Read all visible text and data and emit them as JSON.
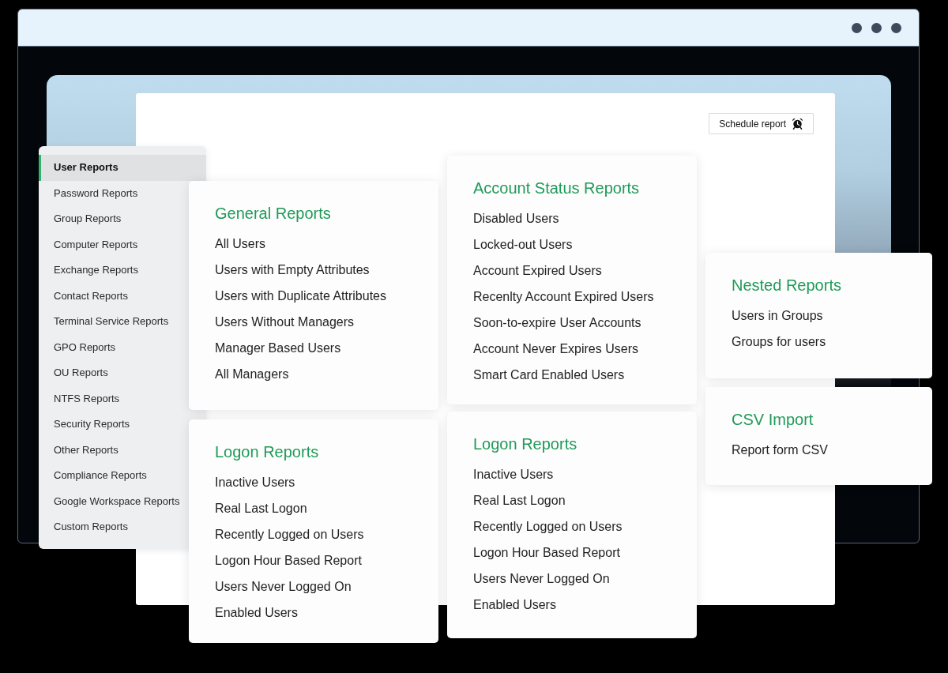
{
  "schedule_button": {
    "label": "Schedule report"
  },
  "sidebar": {
    "items": [
      {
        "label": "User Reports",
        "selected": true
      },
      {
        "label": "Password Reports",
        "selected": false
      },
      {
        "label": "Group Reports",
        "selected": false
      },
      {
        "label": "Computer Reports",
        "selected": false
      },
      {
        "label": "Exchange Reports",
        "selected": false
      },
      {
        "label": "Contact Reports",
        "selected": false
      },
      {
        "label": "Terminal Service Reports",
        "selected": false
      },
      {
        "label": "GPO Reports",
        "selected": false
      },
      {
        "label": "OU Reports",
        "selected": false
      },
      {
        "label": "NTFS Reports",
        "selected": false
      },
      {
        "label": "Security Reports",
        "selected": false
      },
      {
        "label": "Other Reports",
        "selected": false
      },
      {
        "label": "Compliance Reports",
        "selected": false
      },
      {
        "label": "Google Workspace Reports",
        "selected": false
      },
      {
        "label": "Custom Reports",
        "selected": false
      }
    ]
  },
  "cards": [
    {
      "title": "General Reports",
      "items": [
        "All Users",
        "Users with Empty Attributes",
        "Users with Duplicate Attributes",
        "Users Without Managers",
        "Manager Based Users",
        "All Managers"
      ]
    },
    {
      "title": "Logon Reports",
      "items": [
        "Inactive Users",
        "Real Last Logon",
        "Recently Logged on Users",
        "Logon Hour Based Report",
        "Users Never Logged On",
        "Enabled Users"
      ]
    },
    {
      "title": "Account Status Reports",
      "items": [
        "Disabled Users",
        "Locked-out Users",
        "Account Expired Users",
        "Recenlty Account Expired Users",
        "Soon-to-expire User Accounts",
        "Account Never Expires Users",
        "Smart Card Enabled Users"
      ]
    },
    {
      "title": "Logon Reports",
      "items": [
        "Inactive Users",
        "Real Last Logon",
        "Recently Logged on Users",
        "Logon Hour Based Report",
        "Users Never Logged On",
        "Enabled Users"
      ]
    },
    {
      "title": "Nested Reports",
      "items": [
        "Users in Groups",
        "Groups for users"
      ]
    },
    {
      "title": "CSV Import",
      "items": [
        "Report form CSV"
      ]
    }
  ]
}
